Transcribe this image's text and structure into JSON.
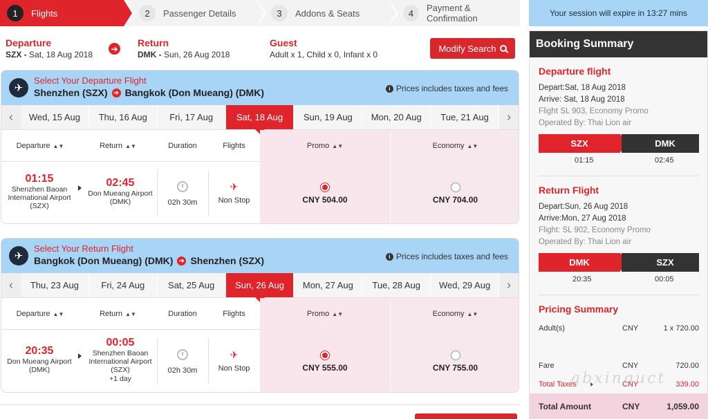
{
  "steps": [
    {
      "num": "1",
      "label": "Flights"
    },
    {
      "num": "2",
      "label": "Passenger Details"
    },
    {
      "num": "3",
      "label": "Addons & Seats"
    },
    {
      "num": "4",
      "label": "Payment & Confirmation"
    }
  ],
  "search": {
    "departure_title": "Departure",
    "departure_code": "SZX -",
    "departure_date": "Sat, 18 Aug 2018",
    "return_title": "Return",
    "return_code": "DMK -",
    "return_date": "Sun, 26 Aug 2018",
    "guest_title": "Guest",
    "guest_value": "Adult x 1, Child x 0, Infant x 0",
    "modify_label": "Modify Search"
  },
  "outbound": {
    "select_label": "Select Your Departure Flight",
    "from": "Shenzhen (SZX)",
    "to": "Bangkok (Don Mueang) (DMK)",
    "tax_note": "Prices includes taxes and fees",
    "dates": [
      "Wed, 15 Aug",
      "Thu, 16 Aug",
      "Fri, 17 Aug",
      "Sat, 18 Aug",
      "Sun, 19 Aug",
      "Mon, 20 Aug",
      "Tue, 21 Aug"
    ],
    "selected_date_index": 3,
    "headers": {
      "departure": "Departure",
      "return": "Return",
      "duration": "Duration",
      "flights": "Flights",
      "promo": "Promo",
      "economy": "Economy"
    },
    "flight": {
      "dep_time": "01:15",
      "dep_airport": "Shenzhen Baoan International Airport (SZX)",
      "arr_time": "02:45",
      "arr_airport": "Don Mueang Airport (DMK)",
      "arr_note": "",
      "duration": "02h 30m",
      "stops": "Non Stop",
      "promo_price": "CNY 504.00",
      "economy_price": "CNY 704.00",
      "selected": "promo"
    }
  },
  "inbound": {
    "select_label": "Select Your Return Flight",
    "from": "Bangkok (Don Mueang) (DMK)",
    "to": "Shenzhen (SZX)",
    "tax_note": "Prices includes taxes and fees",
    "dates": [
      "Thu, 23 Aug",
      "Fri, 24 Aug",
      "Sat, 25 Aug",
      "Sun, 26 Aug",
      "Mon, 27 Aug",
      "Tue, 28 Aug",
      "Wed, 29 Aug"
    ],
    "selected_date_index": 3,
    "headers": {
      "departure": "Departure",
      "return": "Return",
      "duration": "Duration",
      "flights": "Flights",
      "promo": "Promo",
      "economy": "Economy"
    },
    "flight": {
      "dep_time": "20:35",
      "dep_airport": "Don Mueang Airport (DMK)",
      "arr_time": "00:05",
      "arr_airport": "Shenzhen Baoan International Airport (SZX)",
      "arr_note": "+1 day",
      "duration": "02h 30m",
      "stops": "Non Stop",
      "promo_price": "CNY 555.00",
      "economy_price": "CNY 755.00",
      "selected": "promo"
    }
  },
  "session": {
    "text": "Your session will expire in 13:27 mins"
  },
  "summary": {
    "title": "Booking Summary",
    "departure": {
      "heading": "Departure flight",
      "depart": "Depart:Sat, 18 Aug 2018",
      "arrive": "Arrive: Sat, 18 Aug 2018",
      "flight": "Flight SL 903, Economy Promo",
      "operated": "Operated By: Thai Lion air",
      "from_code": "SZX",
      "to_code": "DMK",
      "from_time": "01:15",
      "to_time": "02:45"
    },
    "return": {
      "heading": "Return Flight",
      "depart": "Depart:Sun, 26 Aug 2018",
      "arrive": "Arrive:Mon, 27 Aug 2018",
      "flight": "Flight: SL 902, Economy Promo",
      "operated": "Operated By: Thai Lion air",
      "from_code": "DMK",
      "to_code": "SZX",
      "from_time": "20:35",
      "to_time": "00:05"
    },
    "pricing": {
      "heading": "Pricing Summary",
      "adults_label": "Adult(s)",
      "adults_currency": "CNY",
      "adults_value": "1 x 720.00",
      "fare_label": "Fare",
      "fare_currency": "CNY",
      "fare_value": "720.00",
      "taxes_label": "Total Taxes",
      "taxes_currency": "CNY",
      "taxes_value": "339.00",
      "total_label": "Total Amount",
      "total_currency": "CNY",
      "total_value": "1,059.00"
    },
    "watermark": "abxinguct"
  },
  "colors": {
    "brand_red": "#e0242b",
    "header_blue": "#a8d4f5",
    "dark": "#333333",
    "price_pink": "#f8e6ec"
  }
}
